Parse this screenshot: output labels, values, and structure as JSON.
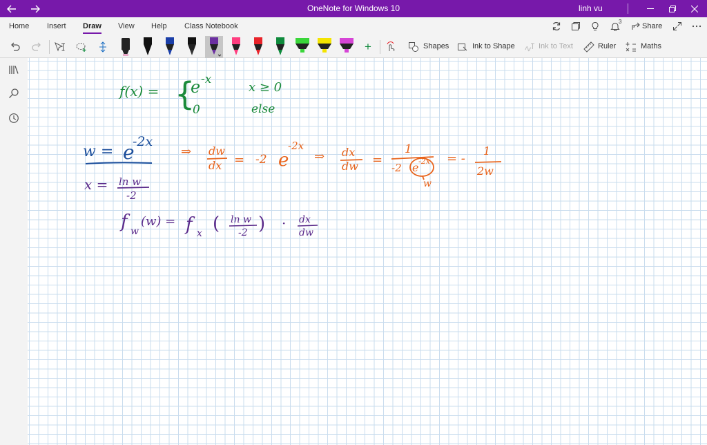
{
  "titlebar": {
    "title": "OneNote for Windows 10",
    "user": "linh vu",
    "accent": "#7719aa"
  },
  "tabs": [
    {
      "label": "Home"
    },
    {
      "label": "Insert"
    },
    {
      "label": "Draw",
      "active": true
    },
    {
      "label": "View"
    },
    {
      "label": "Help"
    },
    {
      "label": "Class Notebook"
    }
  ],
  "ribbon_right": {
    "share_label": "Share",
    "notification_count": "3"
  },
  "toolbar": {
    "shapes_label": "Shapes",
    "ink_to_shape_label": "Ink to Shape",
    "ink_to_text_label": "Ink to Text",
    "ruler_label": "Ruler",
    "maths_label": "Maths",
    "pens": [
      {
        "color": "#e8a8c8",
        "kind": "pen"
      },
      {
        "color": "#111111",
        "kind": "pen"
      },
      {
        "color": "#1b3fa8",
        "kind": "pen"
      },
      {
        "color": "#111111",
        "kind": "pen"
      },
      {
        "color": "#6b2fa0",
        "kind": "pen",
        "selected": true
      },
      {
        "color": "#ff3d7f",
        "kind": "pen"
      },
      {
        "color": "#e8232a",
        "kind": "pen"
      },
      {
        "color": "#0f8a3c",
        "kind": "pen"
      },
      {
        "color": "#3ad63a",
        "kind": "highlighter"
      },
      {
        "color": "#f4e400",
        "kind": "highlighter"
      },
      {
        "color": "#d645d6",
        "kind": "highlighter"
      }
    ]
  },
  "ink": {
    "colors": {
      "green": "#1a8a3a",
      "blue": "#1c4f9c",
      "orange": "#e8641c",
      "purple": "#5a2a8a"
    },
    "line1": {
      "fx": "f(x) =",
      "brace": "{",
      "e": "e",
      "exp": "-x",
      "cond1": "x ≥ 0",
      "zero": "0",
      "else": "else"
    },
    "line2": {
      "w_eq": "w =",
      "e": "e",
      "exp": "-2x"
    },
    "line3": {
      "implies1": "⇒",
      "dw": "dw",
      "dx": "dx",
      "eq1": "=",
      "minus2": "-2",
      "e": "e",
      "exp": "-2x",
      "implies2": "⇒",
      "dx2": "dx",
      "dw2": "dw",
      "eq2": "=",
      "one": "1",
      "den_prefix": "-2",
      "den_e": "e",
      "den_exp": "-2x",
      "den_w": "w",
      "eq3": "= -",
      "one2": "1",
      "two_w": "2w"
    },
    "line4": {
      "x_eq": "x =",
      "num": "ln w",
      "den": "-2"
    },
    "line5": {
      "fw": "f",
      "w_sub": "w",
      "paren_w": "(w) =",
      "fx": "f",
      "x_sub": "x",
      "open": "(",
      "num": "ln w",
      "den": "-2",
      "close": ")",
      "dot": "·",
      "dx": "dx",
      "dw": "dw"
    }
  }
}
